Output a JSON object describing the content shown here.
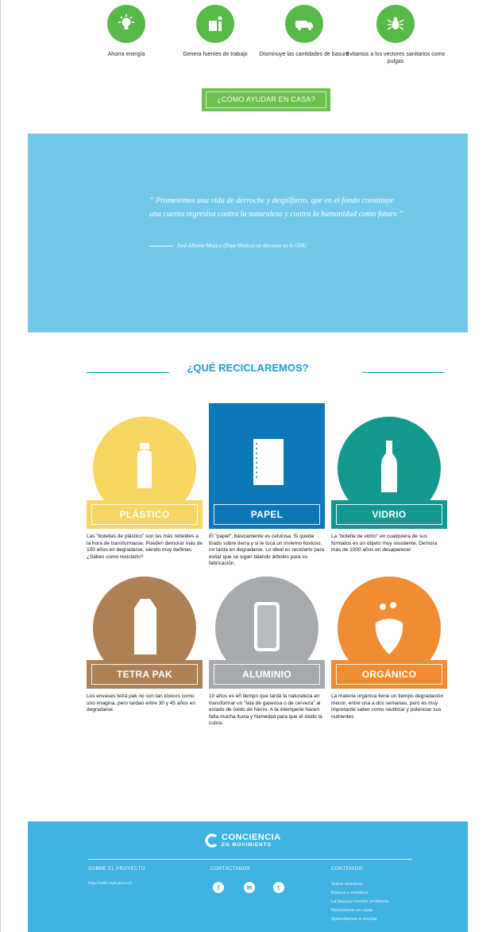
{
  "benefits": [
    {
      "icon": "lightbulb-icon",
      "label": "Ahorra energía"
    },
    {
      "icon": "worker-icon",
      "label": "Genera fuentes de trabajo"
    },
    {
      "icon": "garbage-truck-icon",
      "label": "Disminuye las cantidades de basura"
    },
    {
      "icon": "bug-icon",
      "label": "Evitamos a los vectores sanitarios como pulgas"
    }
  ],
  "how_button": "¿CÓMO AYUDAR EN CASA?",
  "quote": {
    "text": "“ Prometemos una vida de derroche y despilfarro, que en el fondo constituye una cuenta regresiva contra la naturaleza y contra la humanidad como futuro ”",
    "author": "José Alberto Mujica (Pepe Mujica) en discurso en la ONU"
  },
  "recycle_title": "¿QUÉ RECICLAREMOS?",
  "materials": [
    {
      "name": "PLÁSTICO",
      "color": "#f7d662",
      "label_color": "#f7d662",
      "icon": "plastic-bottle-icon",
      "text": "Las \"botellas de plástico\" son las más rebeldes a la hora de transformarse. Pueden demorar más de 100 años en degradarse, siendo muy dañinas. ¿Sábes como reciclarlo?"
    },
    {
      "name": "PAPEL",
      "color": "#0c77b9",
      "label_color": "#0c77b9",
      "icon": "notebook-icon",
      "text": "El \"papel\", básicamente es celulosa. Si queda tirado sobre tierra y si le toca un invierno lluvioso, no tarda en degradarse. Lo ideal es reciclarlo para evitar que se sigan talando árboles para su fabricación."
    },
    {
      "name": "VIDRIO",
      "color": "#13988f",
      "label_color": "#13988f",
      "icon": "glass-bottle-icon",
      "text": "La \"botella de vidrio\" en cualquiera de sus formatos es un objeto muy resistente. Demora más de 1000 años en desaparecer"
    },
    {
      "name": "TETRA PAK",
      "color": "#ae8055",
      "label_color": "#ae8055",
      "icon": "carton-icon",
      "text": "Los envases tetra pak no son tan tóxicos como uno imagina, pero tardan entre 30 y 45 años en degradarse."
    },
    {
      "name": "ALUMINIO",
      "color": "#a6a9ad",
      "label_color": "#a6a9ad",
      "icon": "can-icon",
      "text": "10 años es eñ tiempo que tarda la naturaleza en transformar un \"lata de gaseosa o de cerveza\" al estado de óxido de hierro. A la intemperie hacen falta mucha lluvia y humedad para que el óxido la cubra."
    },
    {
      "name": "ORGÁNICO",
      "color": "#f28c33",
      "label_color": "#f28c33",
      "icon": "vegetable-icon",
      "text": "La materia orgánica  tiene un tiempo degradación menor, entre una a dos semanas, pero es muy importante saber como reutilizar y potenciar sus nutrientes"
    }
  ],
  "footer": {
    "logo_line1": "CONCIENCIA",
    "logo_line2": "EN MOVIMIENTO",
    "about_heading": "SOBRE EL PROYECTO",
    "about_link": "http://wiki.ead.pucv.cl",
    "contact_heading": "CONTÁCTANOS",
    "content_heading": "CONTENIDO",
    "content_links": [
      "Sobre nosotros",
      "Basura y residuos",
      "La basura nuestro problema",
      "Reciclemos en casa",
      "Aprendamos a reciclar"
    ]
  }
}
